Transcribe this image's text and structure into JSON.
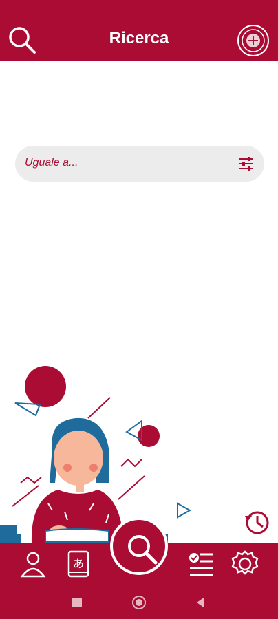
{
  "header": {
    "title": "Ricerca",
    "search_icon": "search-icon",
    "logo": "university-seal"
  },
  "search": {
    "placeholder": "Uguale a...",
    "filter_icon": "filter-sliders-icon"
  },
  "history": {
    "icon": "history-icon"
  },
  "bottom_nav": {
    "items": [
      {
        "icon": "profile-icon"
      },
      {
        "icon": "dictionary-icon"
      },
      {
        "icon": "search-icon"
      },
      {
        "icon": "checklist-icon"
      },
      {
        "icon": "gear-icon"
      }
    ]
  },
  "system_nav": {
    "items": [
      {
        "icon": "recents-square-icon"
      },
      {
        "icon": "home-circle-icon"
      },
      {
        "icon": "back-triangle-icon"
      }
    ]
  },
  "colors": {
    "primary": "#ab0c34",
    "search_bg": "#ececec",
    "white": "#ffffff",
    "illustration_blue": "#1f6c9c",
    "skin": "#f6b79a"
  }
}
